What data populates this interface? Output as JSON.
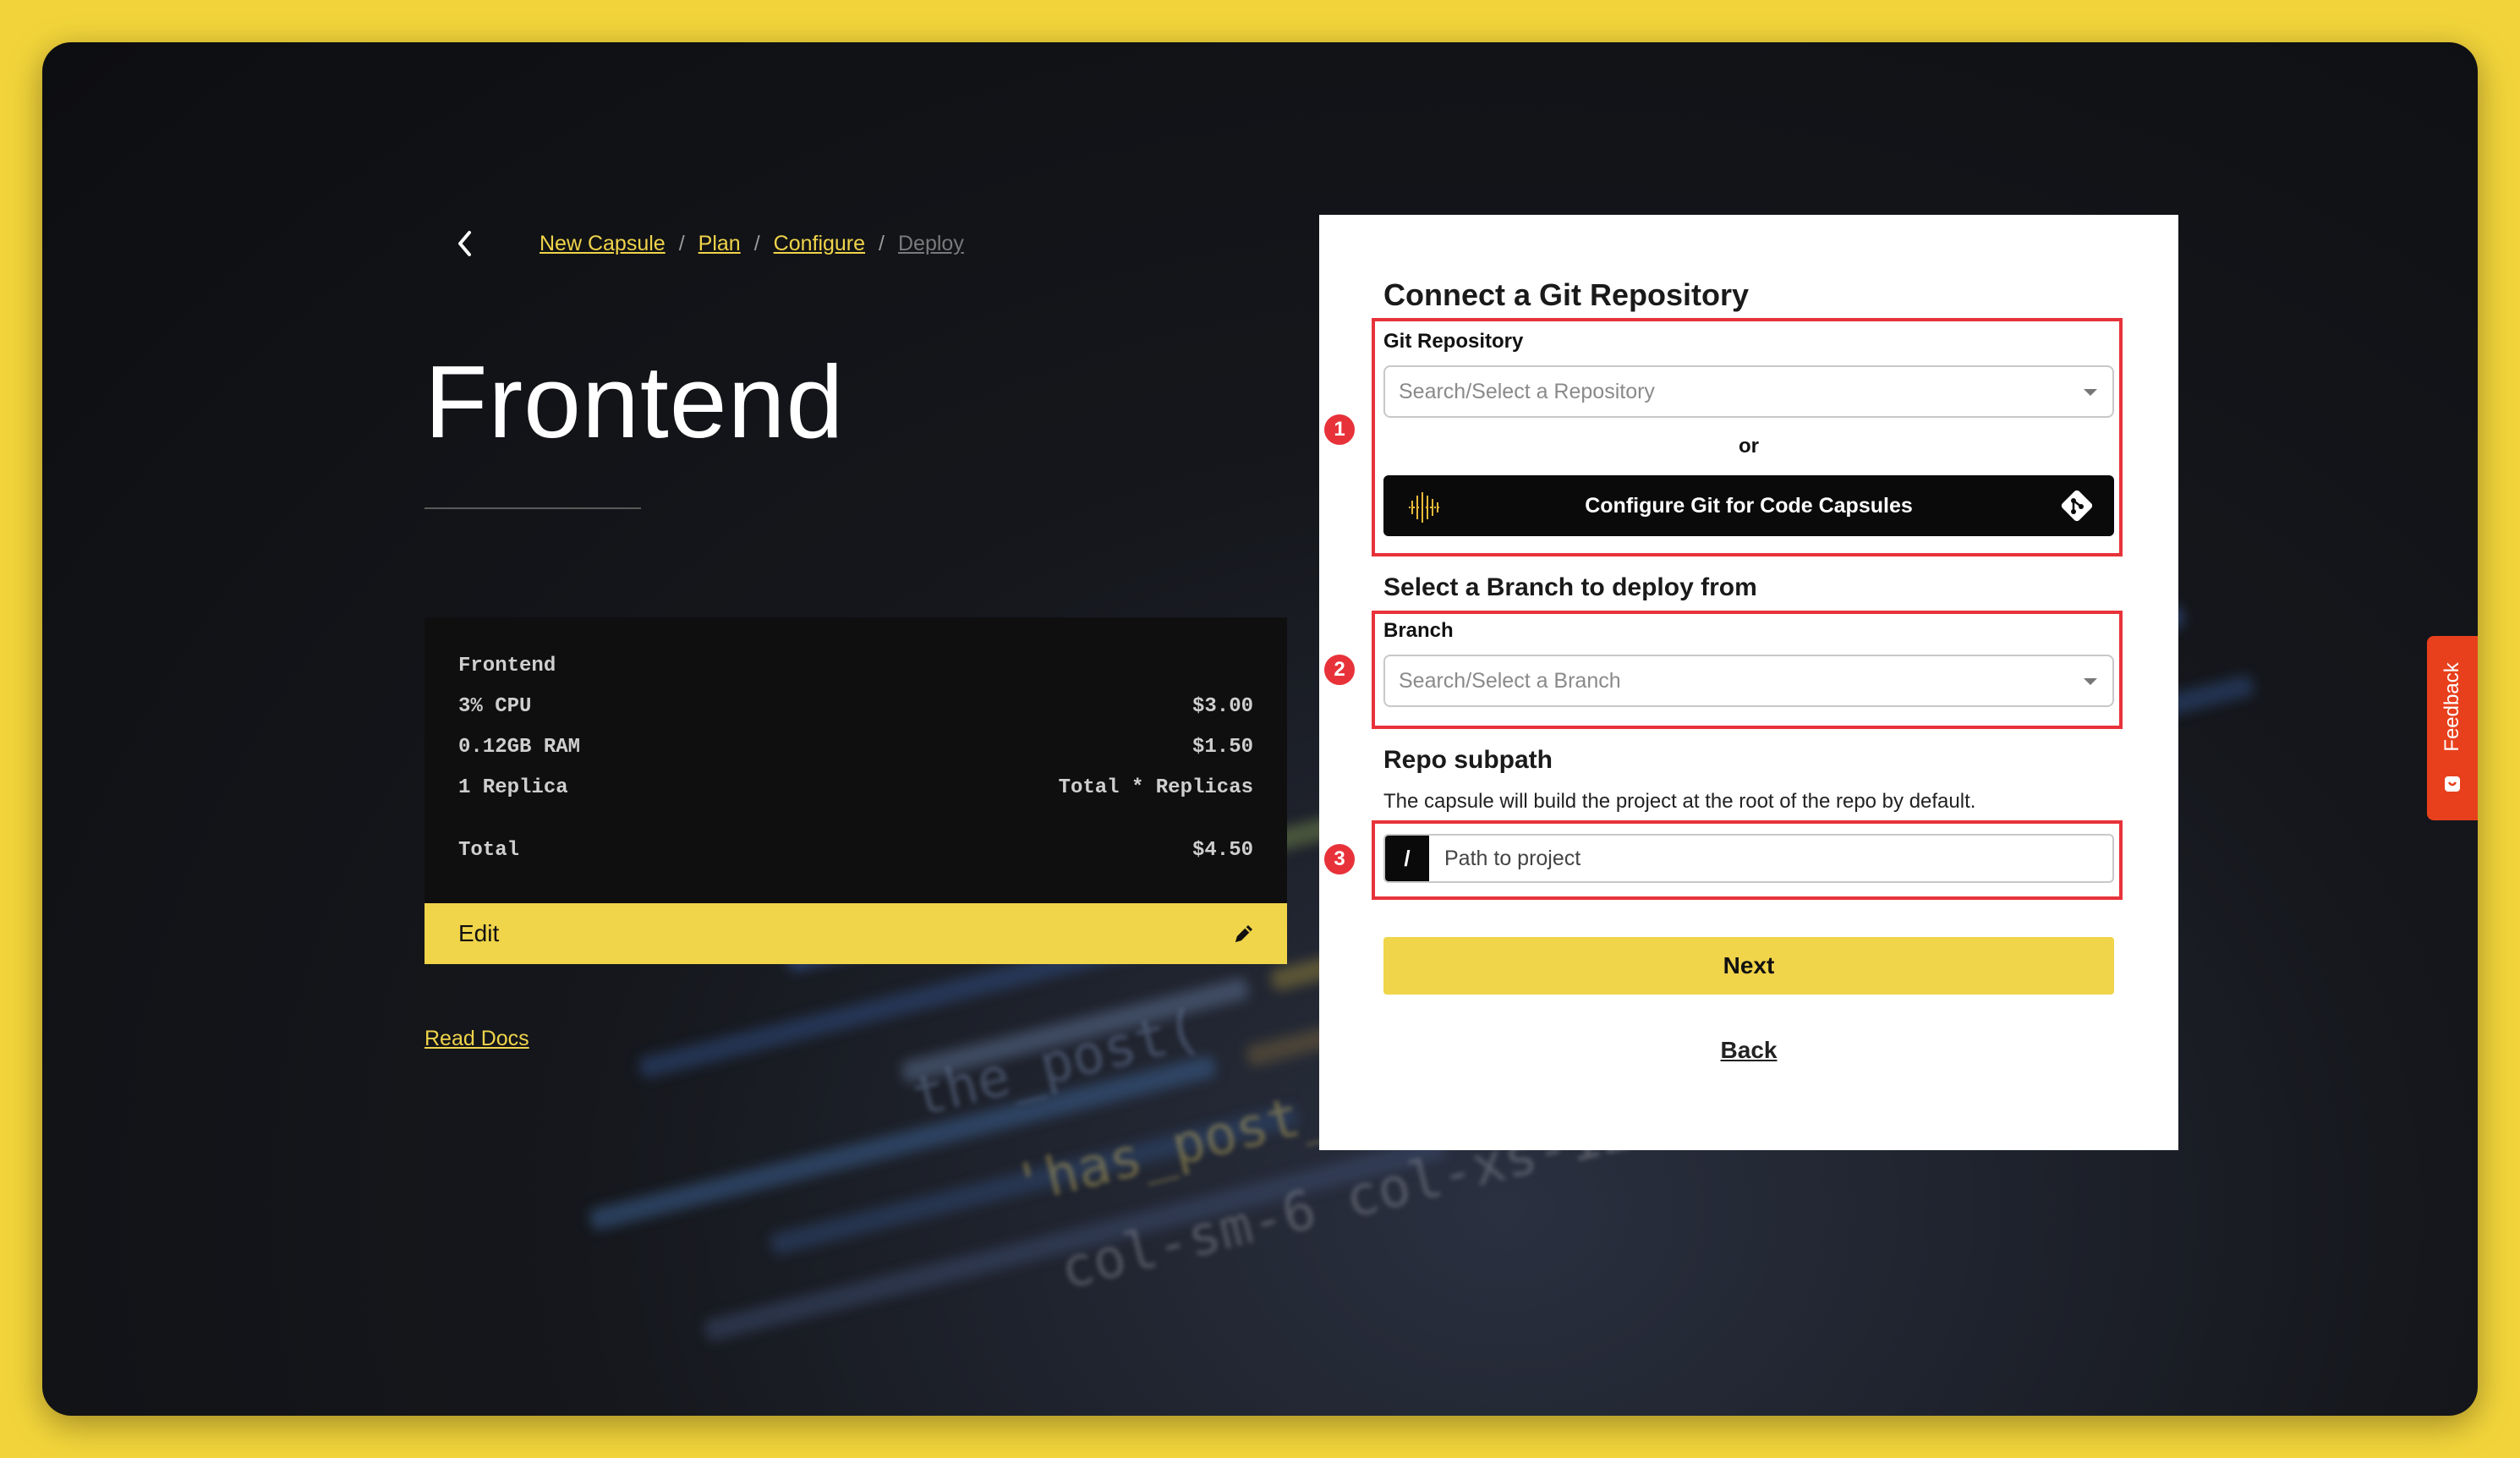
{
  "breadcrumb": {
    "items": [
      {
        "label": "New Capsule",
        "link": true
      },
      {
        "label": "Plan",
        "link": true
      },
      {
        "label": "Configure",
        "link": true
      },
      {
        "label": "Deploy",
        "link": false
      }
    ],
    "separator": "/"
  },
  "page_title": "Frontend",
  "summary": {
    "name": "Frontend",
    "rows": [
      {
        "label": "3% CPU",
        "value": "$3.00"
      },
      {
        "label": "0.12GB RAM",
        "value": "$1.50"
      },
      {
        "label": "1 Replica",
        "value": "Total * Replicas"
      }
    ],
    "total_label": "Total",
    "total_value": "$4.50",
    "edit_label": "Edit"
  },
  "read_docs": "Read Docs",
  "form": {
    "heading": "Connect a Git Repository",
    "repo_label": "Git Repository",
    "repo_placeholder": "Search/Select a Repository",
    "or_text": "or",
    "configure_git_label": "Configure Git for Code Capsules",
    "branch_heading": "Select a Branch to deploy from",
    "branch_label": "Branch",
    "branch_placeholder": "Search/Select a Branch",
    "subpath_heading": "Repo subpath",
    "subpath_help": "The capsule will build the project at the root of the repo by default.",
    "subpath_prefix": "/",
    "subpath_placeholder": "Path to project",
    "next_label": "Next",
    "back_label": "Back"
  },
  "annotations": [
    "1",
    "2",
    "3"
  ],
  "feedback_label": "Feedback",
  "colors": {
    "accent": "#f0d44a",
    "annotation": "#e8323a",
    "feedback": "#e8401c"
  }
}
